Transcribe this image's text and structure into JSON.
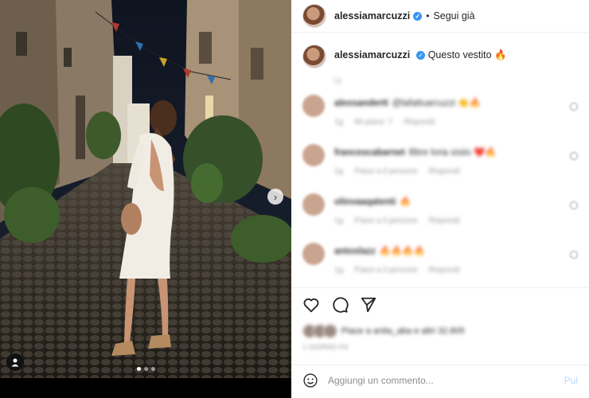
{
  "post": {
    "username": "alessiamarcuzzi",
    "verified_mark": "✓",
    "separator": "•",
    "follow_label": "Segui già",
    "caption_text": "Questo vestito",
    "caption_emoji": "🔥",
    "caption_time": "1g"
  },
  "comments": [
    {
      "user": "alexsandertt",
      "text": "@lafattuarcuzzi 👏🔥",
      "meta": [
        "1g",
        "Mi piace: 7",
        "Rispondi"
      ]
    },
    {
      "user": "francescabarnet",
      "text": "Bbre loria sisiio ❤️🔥",
      "meta": [
        "1g",
        "Piace a il persone",
        "Rispondi"
      ]
    },
    {
      "user": "olinvaaqatenti",
      "text": "🔥",
      "meta": [
        "1g",
        "Piace a il persone",
        "Rispondi"
      ]
    },
    {
      "user": "antoslazz",
      "text": "🔥🔥🔥🔥",
      "meta": [
        "1g",
        "Piace a il persone",
        "Rispondi"
      ]
    }
  ],
  "actions": {
    "like_icon": "heart-icon",
    "comment_icon": "comment-icon",
    "share_icon": "send-icon"
  },
  "likes": {
    "text": "Piace a anita_aba e altri 32.805"
  },
  "date": "1 GIORNO FA",
  "add_comment": {
    "emoji_icon": "smiley-icon",
    "placeholder": "Aggiungi un commento...",
    "publish_label": "Pul"
  },
  "media": {
    "next_icon": "chevron-right-icon",
    "tag_icon": "user-tag-icon",
    "carousel_total": 3,
    "carousel_active": 1
  },
  "colors": {
    "accent": "#3897f0",
    "publish": "#b3dbff"
  }
}
